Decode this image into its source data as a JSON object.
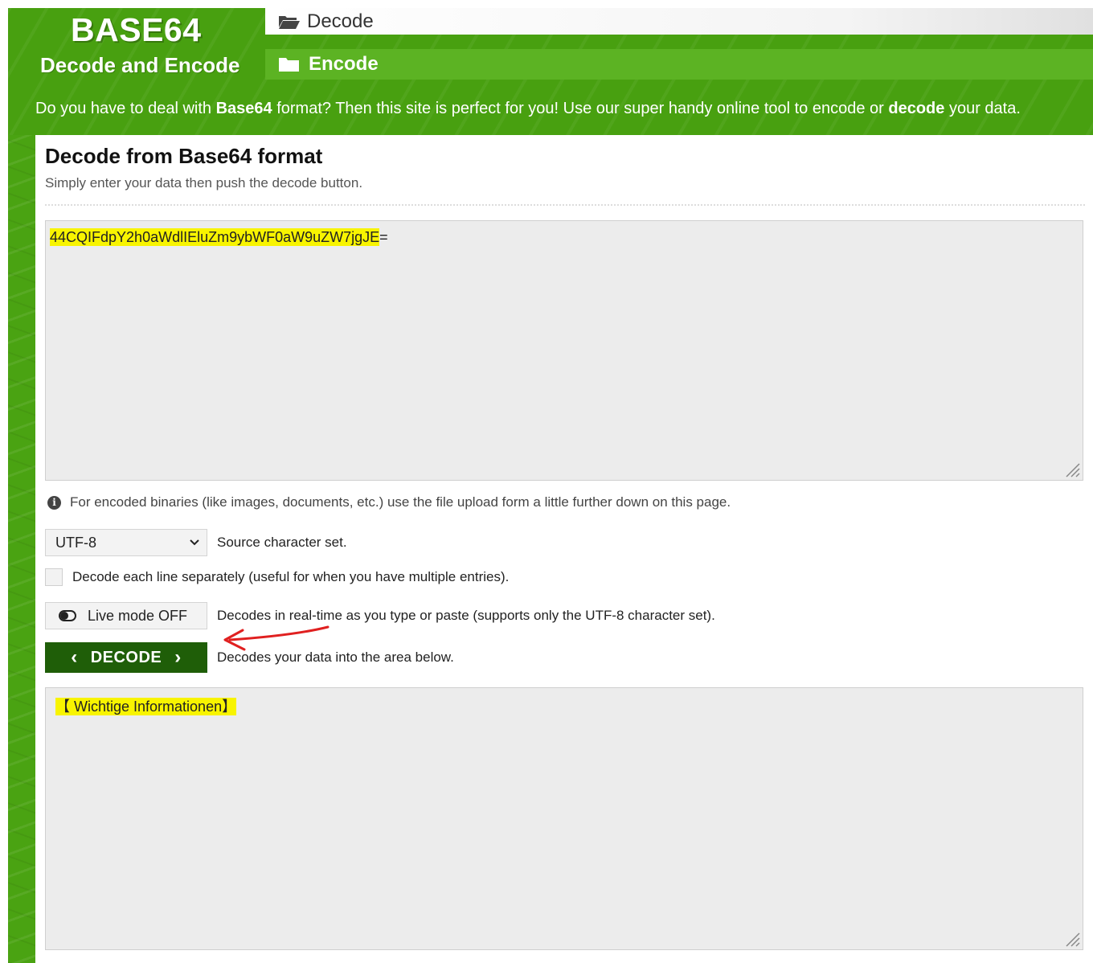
{
  "header": {
    "logo_title": "BASE64",
    "logo_subtitle": "Decode and Encode",
    "nav": [
      {
        "label": "Decode",
        "icon": "folder-open-icon",
        "active": true
      },
      {
        "label": "Encode",
        "icon": "folder-icon",
        "active": false
      }
    ],
    "tagline": {
      "part1": "Do you have to deal with ",
      "bold1": "Base64",
      "part2": " format? Then this site is perfect for you! Use our super handy online tool to encode or ",
      "bold2": "decode",
      "part3": " your data."
    }
  },
  "main": {
    "title": "Decode from Base64 format",
    "subtitle": "Simply enter your data then push the decode button.",
    "input": {
      "value_highlighted": "44CQIFdpY2h0aWdlIEluZm9ybWF0aW9uZW7jgJE",
      "value_tail": "="
    },
    "info_note": "For encoded binaries (like images, documents, etc.) use the file upload form a little further down on this page.",
    "charset": {
      "selected": "UTF-8",
      "label": "Source character set."
    },
    "line_by_line": {
      "checked": false,
      "label": "Decode each line separately (useful for when you have multiple entries)."
    },
    "live_mode": {
      "label": "Live mode OFF",
      "description": "Decodes in real-time as you type or paste (supports only the UTF-8 character set)."
    },
    "decode_button": {
      "label": "DECODE",
      "description": "Decodes your data into the area below."
    },
    "output": {
      "value": "【 Wichtige Informationen】"
    }
  },
  "colors": {
    "brand_green": "#48a010",
    "nav_green": "#5cb323",
    "button_dark_green": "#1f5e08",
    "highlight_yellow": "#f8f400",
    "annotation_red": "#e02020"
  }
}
